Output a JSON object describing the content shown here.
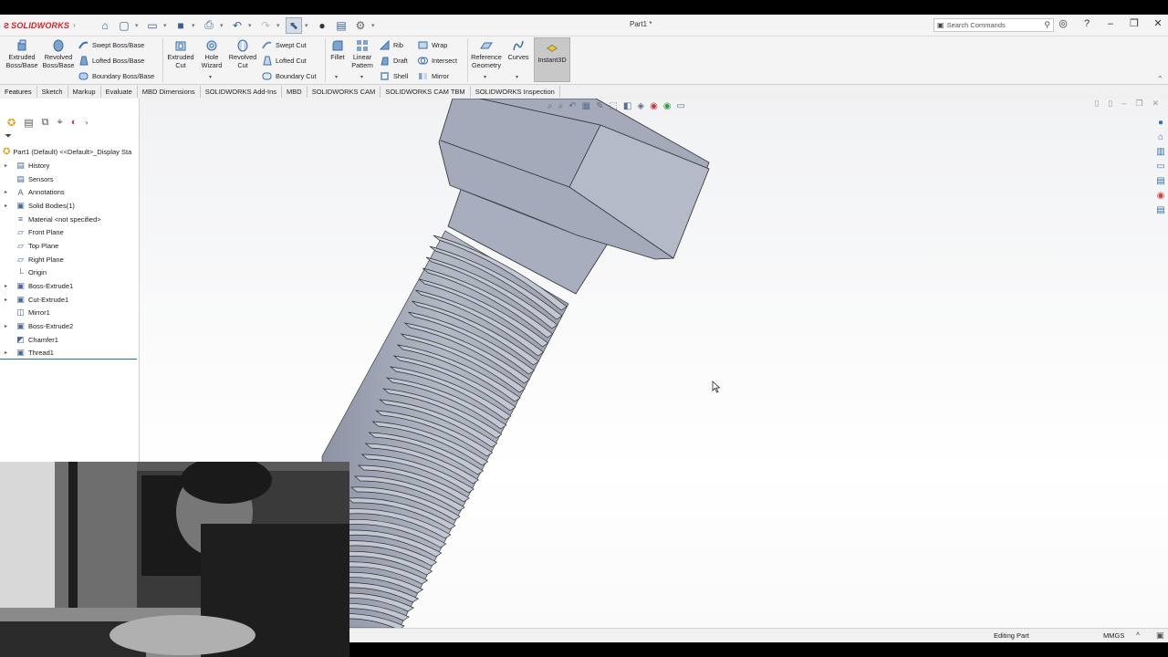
{
  "app": {
    "brand": "SOLIDWORKS",
    "document_title": "Part1 *",
    "search_placeholder": "Search Commands"
  },
  "ribbon": {
    "extruded_boss": "Extruded Boss/Base",
    "revolved_boss": "Revolved Boss/Base",
    "swept_boss": "Swept Boss/Base",
    "lofted_boss": "Lofted Boss/Base",
    "boundary_boss": "Boundary Boss/Base",
    "extruded_cut": "Extruded Cut",
    "hole_wizard": "Hole Wizard",
    "revolved_cut": "Revolved Cut",
    "swept_cut": "Swept Cut",
    "lofted_cut": "Lofted Cut",
    "boundary_cut": "Boundary Cut",
    "fillet": "Fillet",
    "linear_pattern": "Linear Pattern",
    "rib": "Rib",
    "draft": "Draft",
    "shell": "Shell",
    "wrap": "Wrap",
    "intersect": "Intersect",
    "mirror": "Mirror",
    "reference_geometry": "Reference Geometry",
    "curves": "Curves",
    "instant3d": "Instant3D"
  },
  "tabs": [
    "Features",
    "Sketch",
    "Markup",
    "Evaluate",
    "MBD Dimensions",
    "SOLIDWORKS Add-Ins",
    "MBD",
    "SOLIDWORKS CAM",
    "SOLIDWORKS CAM TBM",
    "SOLIDWORKS Inspection"
  ],
  "tree": {
    "root": "Part1 (Default) <<Default>_Display Sta",
    "items": [
      {
        "label": "History",
        "expandable": true
      },
      {
        "label": "Sensors",
        "expandable": false
      },
      {
        "label": "Annotations",
        "expandable": true
      },
      {
        "label": "Solid Bodies(1)",
        "expandable": true
      },
      {
        "label": "Material <not specified>",
        "expandable": false
      },
      {
        "label": "Front Plane",
        "expandable": false
      },
      {
        "label": "Top Plane",
        "expandable": false
      },
      {
        "label": "Right Plane",
        "expandable": false
      },
      {
        "label": "Origin",
        "expandable": false
      },
      {
        "label": "Boss-Extrude1",
        "expandable": true
      },
      {
        "label": "Cut-Extrude1",
        "expandable": true
      },
      {
        "label": "Mirror1",
        "expandable": false
      },
      {
        "label": "Boss-Extrude2",
        "expandable": true
      },
      {
        "label": "Chamfer1",
        "expandable": false
      },
      {
        "label": "Thread1",
        "expandable": true
      }
    ]
  },
  "status": {
    "mode": "Editing Part",
    "units": "MMGS"
  },
  "colors": {
    "accent": "#d2232a",
    "model_gray": "#a7adbc",
    "selection_blue": "#2a6ab1"
  }
}
